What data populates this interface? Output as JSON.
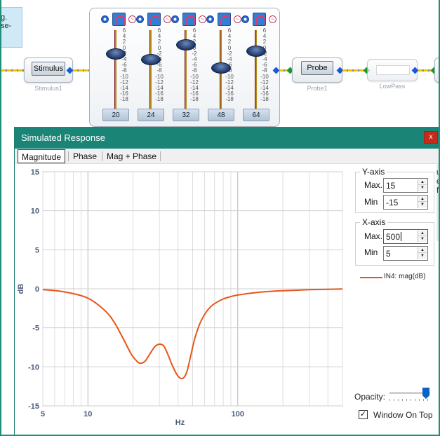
{
  "canvas": {
    "note_text": [
      "g.",
      "se-"
    ],
    "stimulus": {
      "button": "Stimulus",
      "label": "Stimulus1"
    },
    "probe": {
      "button": "Probe",
      "label": "Probe1"
    },
    "lowpass": {
      "label": "LowPass"
    },
    "peq": {
      "tick_labels": [
        "6",
        "4",
        "2",
        "0",
        "-2",
        "-4",
        "-6",
        "-8",
        "-10",
        "-12",
        "-14",
        "-16",
        "-18"
      ],
      "bands": [
        {
          "freq": "20",
          "gain_db": -1
        },
        {
          "freq": "24",
          "gain_db": -3
        },
        {
          "freq": "32",
          "gain_db": 2
        },
        {
          "freq": "48",
          "gain_db": -6
        },
        {
          "freq": "64",
          "gain_db": 0
        }
      ]
    }
  },
  "dialog": {
    "title": "Simulated Response",
    "close_label": "x",
    "tabs": [
      {
        "label": "Magnitude",
        "active": true
      },
      {
        "label": "Phase",
        "active": false
      },
      {
        "label": "Mag + Phase",
        "active": false
      }
    ],
    "yaxis": {
      "title": "Y-axis",
      "max_label": "Max.",
      "max_value": "15",
      "min_label": "Min",
      "min_value": "-15"
    },
    "xaxis": {
      "title": "X-axis",
      "max_label": "Max.",
      "max_value": "500",
      "min_label": "Min",
      "min_value": "5"
    },
    "legend": {
      "entry": "IN4: mag(dB)",
      "color": "#e8541a"
    },
    "opacity": {
      "label": "Opacity:",
      "value": 0.9
    },
    "window_on_top": {
      "label": "Window On Top",
      "checked": true
    },
    "cut_text": [
      "u",
      "e",
      "ff"
    ]
  },
  "chart_data": {
    "type": "line",
    "xlabel": "Hz",
    "ylabel": "dB",
    "xscale": "log",
    "xlim": [
      5,
      500
    ],
    "ylim": [
      -15,
      15
    ],
    "x_tick_labels": [
      "5",
      "10",
      "100"
    ],
    "y_ticks": [
      15,
      10,
      5,
      0,
      -5,
      -10,
      -15
    ],
    "grid": true,
    "series": [
      {
        "name": "IN4: mag(dB)",
        "color": "#e8541a",
        "x": [
          5,
          7,
          10,
          13,
          15,
          17,
          19,
          20,
          22,
          24,
          26,
          28,
          30,
          32,
          34,
          36,
          38,
          40,
          42,
          44,
          46,
          48,
          50,
          52,
          55,
          58,
          62,
          66,
          70,
          80,
          90,
          100,
          130,
          160,
          200,
          300,
          400,
          500
        ],
        "y": [
          -0.1,
          -0.4,
          -1.2,
          -2.8,
          -4.3,
          -6.2,
          -8.0,
          -8.7,
          -9.5,
          -9.3,
          -8.3,
          -7.4,
          -7.1,
          -7.3,
          -8.3,
          -9.5,
          -10.5,
          -11.2,
          -11.5,
          -11.3,
          -10.5,
          -9.0,
          -7.5,
          -6.2,
          -4.8,
          -3.8,
          -2.9,
          -2.3,
          -1.9,
          -1.3,
          -1.0,
          -0.8,
          -0.5,
          -0.35,
          -0.25,
          -0.12,
          -0.06,
          -0.03
        ]
      }
    ]
  }
}
